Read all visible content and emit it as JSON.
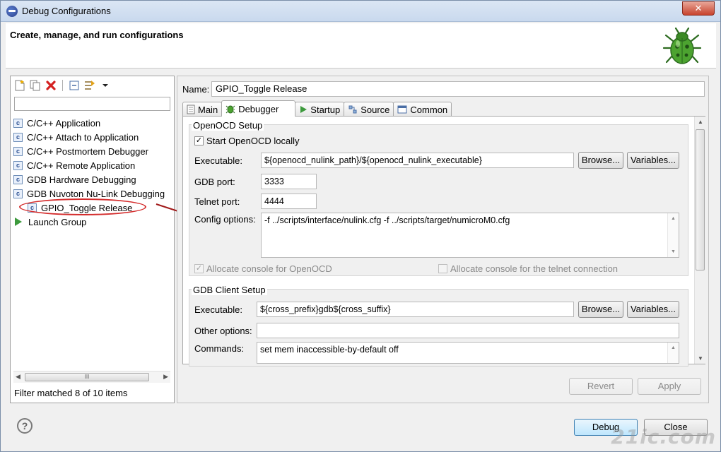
{
  "window": {
    "title": "Debug Configurations",
    "close_glyph": "✕"
  },
  "banner": {
    "heading": "Create, manage, and run configurations"
  },
  "left": {
    "filter_value": "",
    "tree": [
      {
        "label": "C/C++ Application",
        "icon": "c-config-icon",
        "level": 0
      },
      {
        "label": "C/C++ Attach to Application",
        "icon": "c-config-icon",
        "level": 0
      },
      {
        "label": "C/C++ Postmortem Debugger",
        "icon": "c-config-icon",
        "level": 0
      },
      {
        "label": "C/C++ Remote Application",
        "icon": "c-config-icon",
        "level": 0
      },
      {
        "label": "GDB Hardware Debugging",
        "icon": "c-config-icon",
        "level": 0
      },
      {
        "label": "GDB Nuvoton Nu-Link Debugging",
        "icon": "c-config-icon",
        "level": 0
      },
      {
        "label": "GPIO_Toggle Release",
        "icon": "c-config-icon",
        "level": 1
      },
      {
        "label": "Launch Group",
        "icon": "launch-group-icon",
        "level": 0
      }
    ],
    "scroll_grip": "III",
    "filter_status": "Filter matched 8 of 10 items"
  },
  "right": {
    "name_label": "Name:",
    "name_value": "GPIO_Toggle Release",
    "tabs": [
      "Main",
      "Debugger",
      "Startup",
      "Source",
      "Common"
    ],
    "active_tab": "Debugger",
    "openocd": {
      "title": "OpenOCD Setup",
      "start_locally_label": "Start OpenOCD locally",
      "start_locally_checked": true,
      "executable_label": "Executable:",
      "executable_value": "${openocd_nulink_path}/${openocd_nulink_executable}",
      "gdb_port_label": "GDB port:",
      "gdb_port_value": "3333",
      "telnet_port_label": "Telnet port:",
      "telnet_port_value": "4444",
      "config_label": "Config options:",
      "config_value": "-f ../scripts/interface/nulink.cfg -f ../scripts/target/numicroM0.cfg",
      "alloc_console_label": "Allocate console for OpenOCD",
      "alloc_console_checked": true,
      "alloc_telnet_label": "Allocate console for the telnet connection",
      "alloc_telnet_checked": false
    },
    "gdbclient": {
      "title": "GDB Client Setup",
      "executable_label": "Executable:",
      "executable_value": "${cross_prefix}gdb${cross_suffix}",
      "other_label": "Other options:",
      "other_value": "",
      "commands_label": "Commands:",
      "commands_value": "set mem inaccessible-by-default off"
    },
    "browse_label": "Browse...",
    "variables_label": "Variables...",
    "revert_label": "Revert",
    "apply_label": "Apply"
  },
  "footer": {
    "help_glyph": "?",
    "debug_label": "Debug",
    "close_label": "Close",
    "watermark": "21ic.com"
  }
}
